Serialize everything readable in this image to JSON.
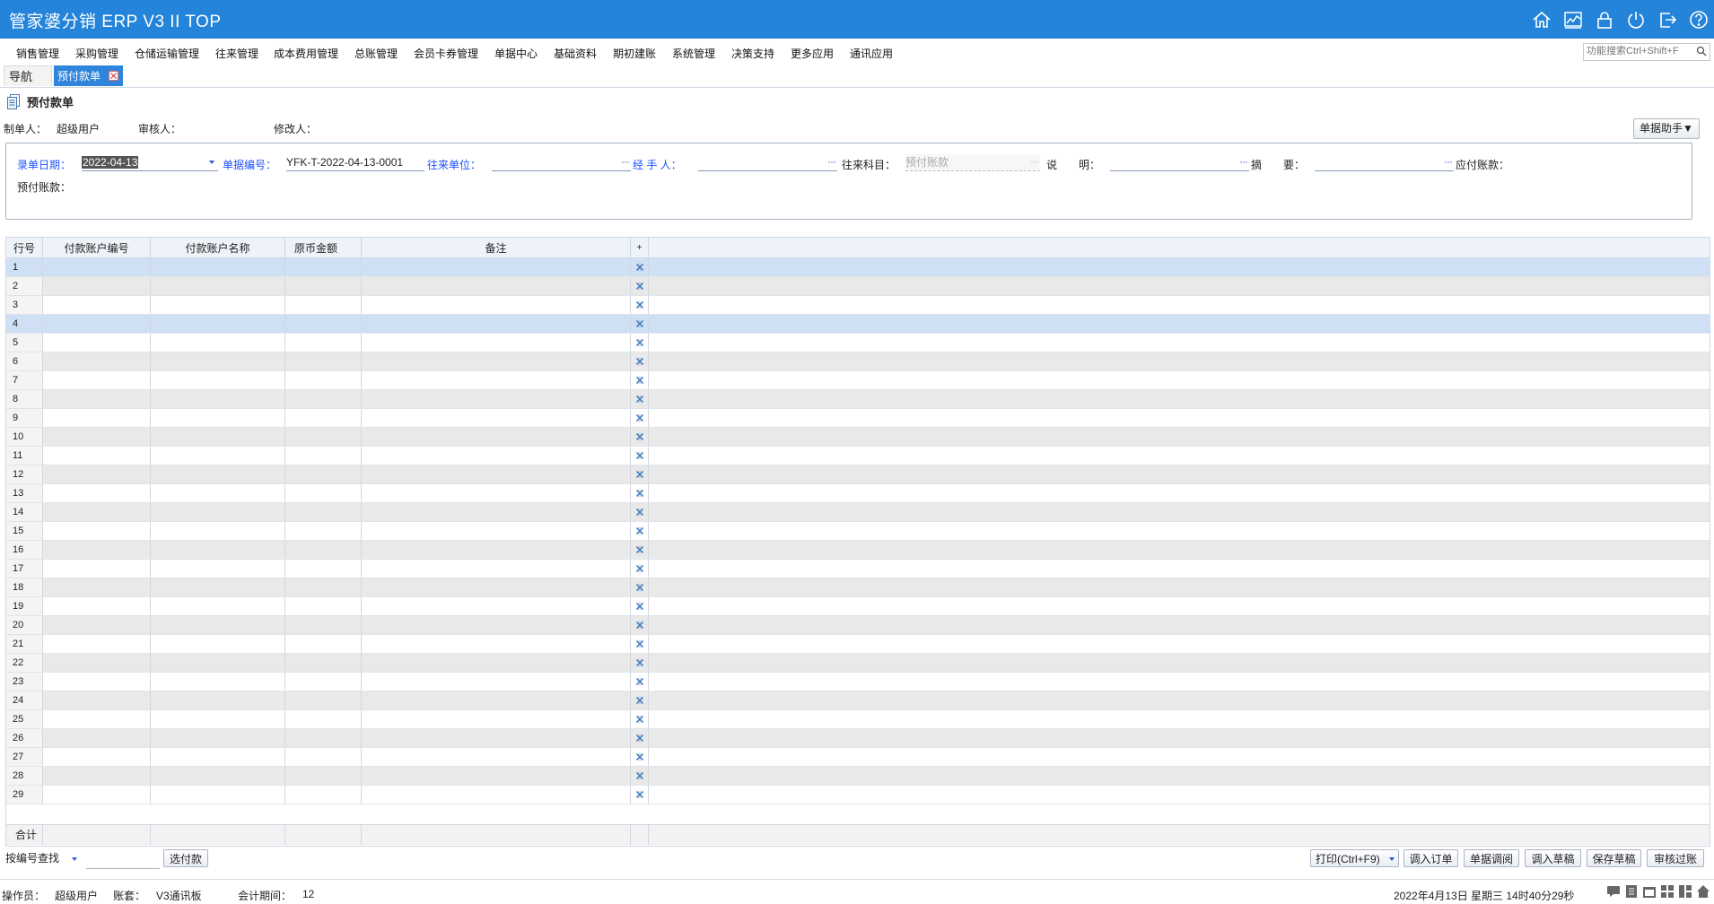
{
  "app": {
    "title": "管家婆分销 ERP V3 II TOP"
  },
  "top_icons": [
    "home-icon",
    "chart-icon",
    "lock-icon",
    "power-icon",
    "logout-icon",
    "help-icon"
  ],
  "menu": [
    "销售管理",
    "采购管理",
    "仓储运输管理",
    "往来管理",
    "成本费用管理",
    "总账管理",
    "会员卡券管理",
    "单据中心",
    "基础资料",
    "期初建账",
    "系统管理",
    "决策支持",
    "更多应用",
    "通讯应用"
  ],
  "search": {
    "placeholder": "功能搜索Ctrl+Shift+F"
  },
  "tabs": {
    "nav": "导航",
    "active": "预付款单"
  },
  "document": {
    "title": "预付款单",
    "maker_label": "制单人：",
    "maker_value": "超级用户",
    "auditor_label": "审核人：",
    "auditor_value": "",
    "modifier_label": "修改人：",
    "modifier_value": "",
    "helper_button": "单据助手▼"
  },
  "form": {
    "date_label": "录单日期：",
    "date_value": "2022-04-13",
    "number_label": "单据编号：",
    "number_value": "YFK-T-2022-04-13-0001",
    "partner_label": "往来单位：",
    "partner_value": "",
    "handler_label": "经 手 人：",
    "handler_value": "",
    "account_subject_label": "往来科目：",
    "account_subject_value": "预付账款",
    "explain_label": "说　　明：",
    "explain_value": "",
    "summary_label": "摘　　要：",
    "summary_value": "",
    "payable_label": "应付账款：",
    "prepaid_label": "预付账款："
  },
  "grid": {
    "columns": [
      "行号",
      "付款账户编号",
      "付款账户名称",
      "原币金额",
      "备注",
      "+"
    ],
    "rows": [
      "1",
      "2",
      "3",
      "4",
      "5",
      "6",
      "7",
      "8",
      "9",
      "10",
      "11",
      "12",
      "13",
      "14",
      "15",
      "16",
      "17",
      "18",
      "19",
      "20",
      "21",
      "22",
      "23",
      "24",
      "25",
      "26",
      "27",
      "28",
      "29"
    ],
    "selected_rows": [
      1,
      4
    ],
    "total_label": "合计"
  },
  "bottom": {
    "query_select": "按编号查找",
    "query_input": "",
    "select_payment": "选付款",
    "print": "打印(Ctrl+F9)",
    "import_order": "调入订单",
    "doc_lookup": "单据调阅",
    "import_draft": "调入草稿",
    "save_draft": "保存草稿",
    "audit_post": "审核过账"
  },
  "status": {
    "operator_label": "操作员：",
    "operator_value": "超级用户",
    "account_label": "账套：",
    "account_value": "V3通讯板",
    "period_label": "会计期间：",
    "period_value": "12",
    "datetime": "2022年4月13日  星期三  14时40分29秒"
  },
  "colors": {
    "titlebar": "#2384d9",
    "tab_active": "#2f85dc",
    "selected_row": "#cfe0f4",
    "label_blue": "#1b50ff"
  }
}
